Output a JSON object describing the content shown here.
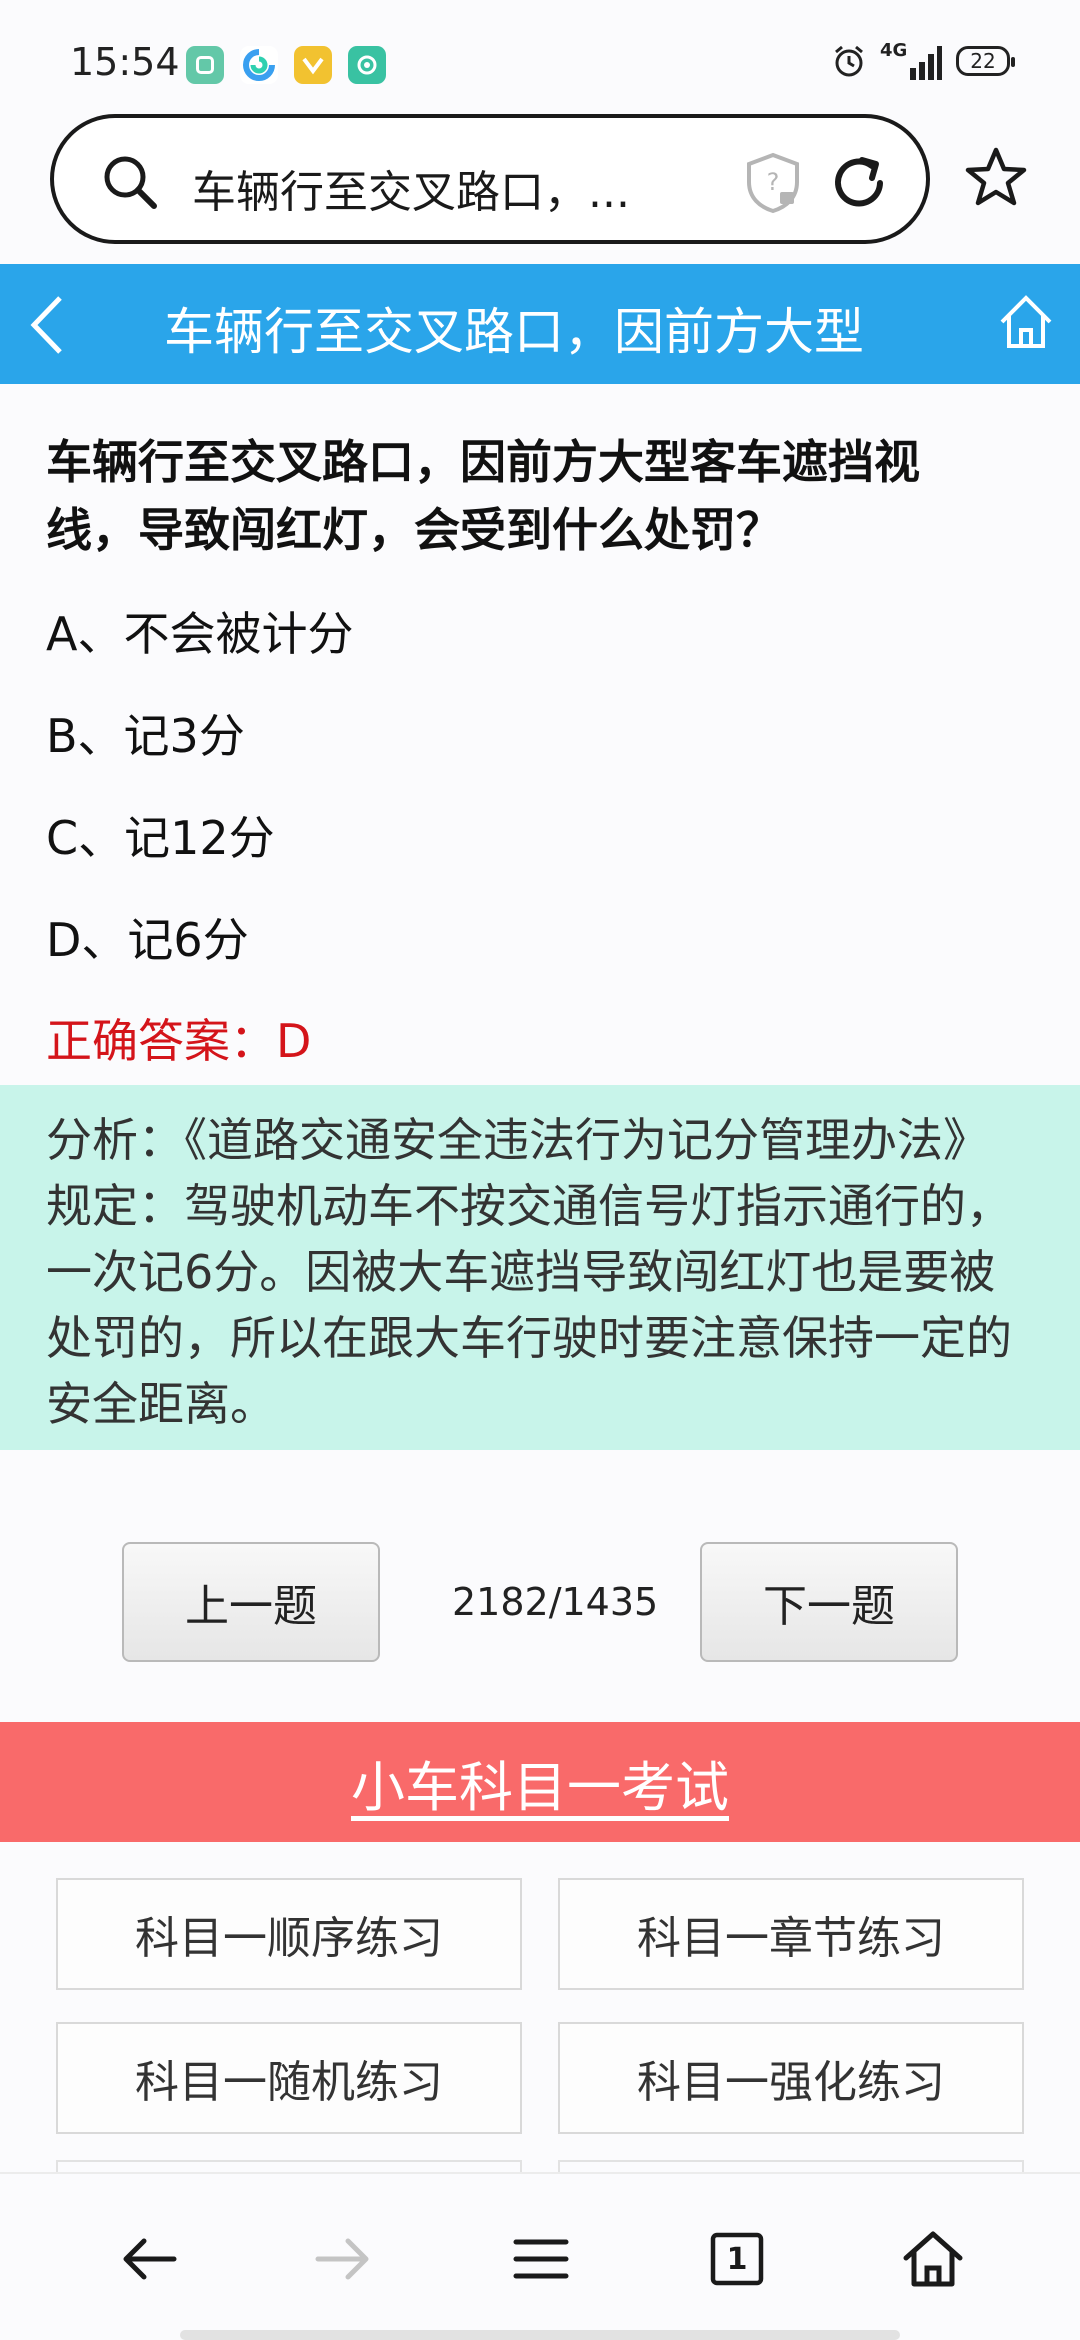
{
  "status_bar": {
    "time": "15:54",
    "notif_colors": [
      "#63c8a8",
      "#3aa0f0",
      "#f2c230",
      "#39c2a2"
    ],
    "network": "4G",
    "battery": "22"
  },
  "search": {
    "query": "车辆行至交叉路口，..."
  },
  "header": {
    "title": "车辆行至交叉路口，因前方大型"
  },
  "question": {
    "text": "车辆行至交叉路口，因前方大型客车遮挡视线，导致闯红灯，会受到什么处罚？",
    "options": [
      "A、不会被计分",
      "B、记3分",
      "C、记12分",
      "D、记6分"
    ],
    "answer": "正确答案：D"
  },
  "analysis": {
    "text": "分析：《道路交通安全违法行为记分管理办法》规定：驾驶机动车不按交通信号灯指示通行的，一次记6分。因被大车遮挡导致闯红灯也是要被处罚的，所以在跟大车行驶时要注意保持一定的安全距离。"
  },
  "pager": {
    "prev_label": "上一题",
    "next_label": "下一题",
    "counter": "2182/1435"
  },
  "exam": {
    "banner_label": "小车科目一考试"
  },
  "practice": {
    "items": [
      "科目一顺序练习",
      "科目一章节练习",
      "科目一随机练习",
      "科目一强化练习"
    ]
  },
  "colors": {
    "header_blue": "#2aa5ea",
    "answer_red": "#d4141a",
    "analysis_bg": "#c8f4ea",
    "banner_red": "#f96a6a"
  },
  "bottom_nav": {
    "tab_count": "1"
  }
}
